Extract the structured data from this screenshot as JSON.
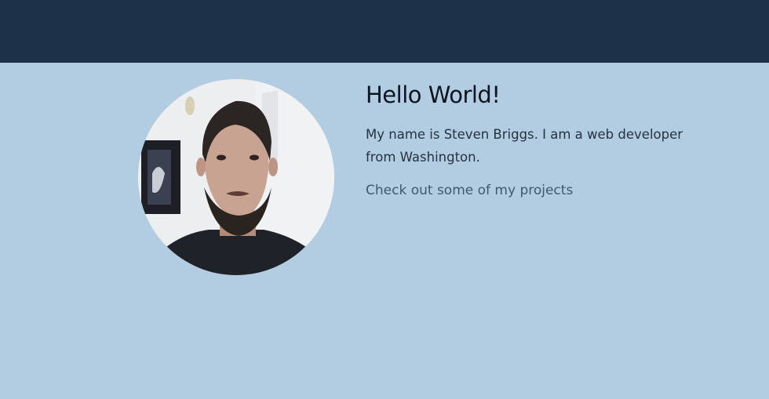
{
  "header": {
    "background_color": "#1d3248"
  },
  "page": {
    "background_color": "#b2cde2"
  },
  "profile": {
    "photo_icon": "profile-photo"
  },
  "intro": {
    "title": "Hello World!",
    "bio": "My name is Steven Briggs. I am a web developer from Washington.",
    "projects_link": "Check out some of my projects"
  }
}
